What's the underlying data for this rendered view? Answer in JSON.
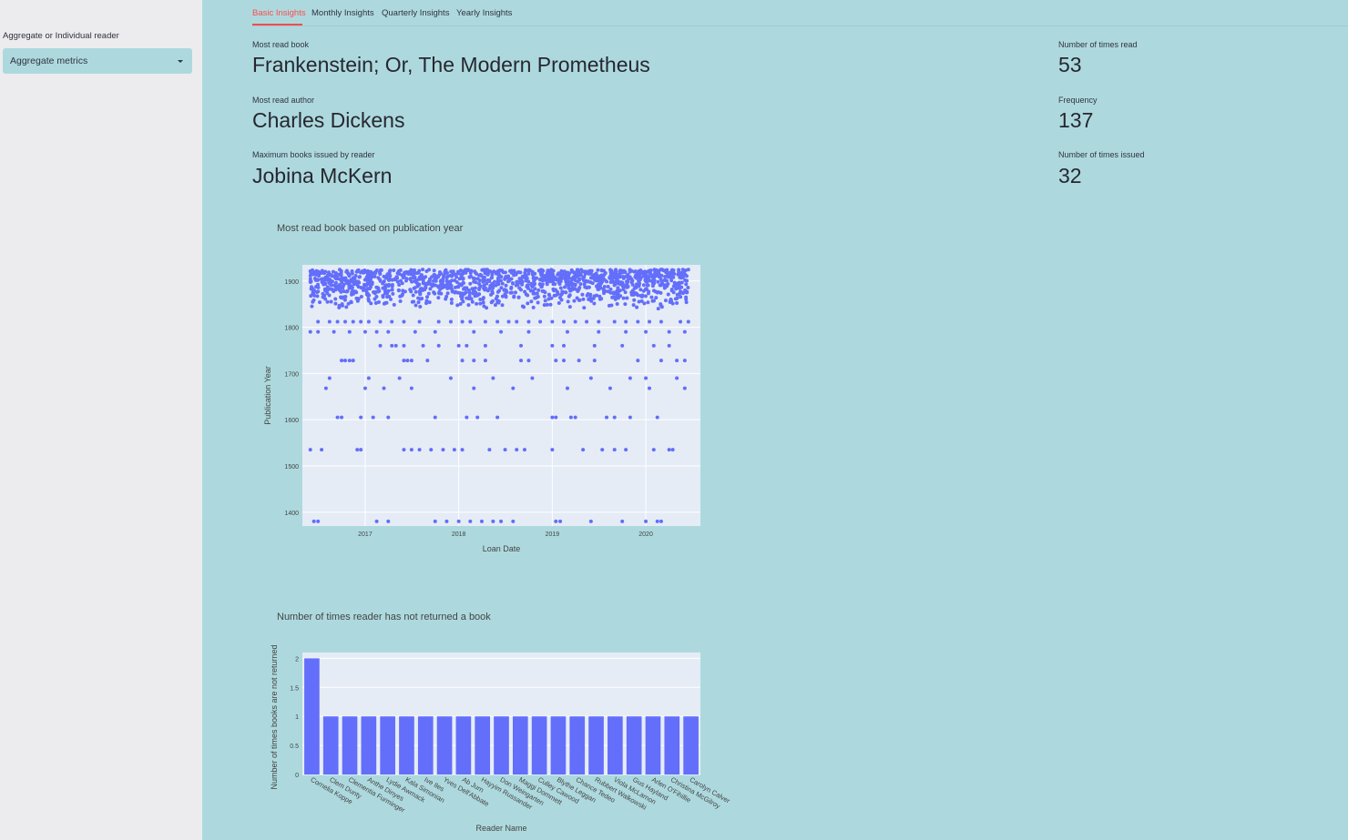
{
  "sidebar": {
    "select_label": "Aggregate or Individual reader",
    "select_value": "Aggregate metrics"
  },
  "tabs": [
    {
      "label": "Basic Insights",
      "active": true
    },
    {
      "label": "Monthly Insights",
      "active": false
    },
    {
      "label": "Quarterly Insights",
      "active": false
    },
    {
      "label": "Yearly Insights",
      "active": false
    }
  ],
  "metrics": {
    "most_read_book": {
      "label": "Most read book",
      "value": "Frankenstein; Or, The Modern Prometheus"
    },
    "times_read": {
      "label": "Number of times read",
      "value": "53"
    },
    "most_read_author": {
      "label": "Most read author",
      "value": "Charles Dickens"
    },
    "frequency": {
      "label": "Frequency",
      "value": "137"
    },
    "max_books_reader": {
      "label": "Maximum books issued by reader",
      "value": "Jobina McKern"
    },
    "times_issued": {
      "label": "Number of times issued",
      "value": "32"
    }
  },
  "colors": {
    "accent": "#ff4b4b",
    "marker": "#636efa",
    "plot_bg": "#e5ecf6",
    "page_bg": "#add9de",
    "sidebar_bg": "#ececee"
  },
  "chart_data": [
    {
      "type": "scatter",
      "title": "Most read book based on publication year",
      "xlabel": "Loan Date",
      "ylabel": "Publication Year",
      "x_ticks": [
        "2017",
        "2018",
        "2019",
        "2020"
      ],
      "y_ticks": [
        "1400",
        "1500",
        "1600",
        "1700",
        "1800",
        "1900"
      ],
      "xlim": [
        "2016-05-01",
        "2020-08-01"
      ],
      "ylim": [
        1370,
        1935
      ],
      "grid": true,
      "series": [
        {
          "bands": [
            {
              "year": 1380,
              "dates": [
                "2016-06-15",
                "2016-07-01",
                "2017-02-15",
                "2017-04-01",
                "2017-10-01",
                "2017-11-15",
                "2018-01-01",
                "2018-02-15",
                "2018-04-01",
                "2018-05-15",
                "2018-06-15",
                "2018-08-01",
                "2019-01-15",
                "2019-02-01",
                "2019-06-01",
                "2019-10-01",
                "2020-01-01",
                "2020-02-15",
                "2020-03-01"
              ]
            },
            {
              "year": 1535,
              "dates": [
                "2016-06-01",
                "2016-07-15",
                "2016-12-01",
                "2016-12-15",
                "2017-06-01",
                "2017-07-01",
                "2017-08-01",
                "2017-09-15",
                "2017-11-01",
                "2017-12-15",
                "2018-01-15",
                "2018-05-01",
                "2018-07-01",
                "2018-08-15",
                "2018-09-15",
                "2019-01-01",
                "2019-05-01",
                "2019-07-15",
                "2019-09-01",
                "2019-10-15",
                "2020-02-01",
                "2020-04-01",
                "2020-04-15"
              ]
            },
            {
              "year": 1605,
              "dates": [
                "2016-09-15",
                "2016-10-01",
                "2016-12-15",
                "2017-02-01",
                "2017-04-01",
                "2017-10-01",
                "2018-02-01",
                "2018-03-15",
                "2018-06-01",
                "2019-01-01",
                "2019-01-15",
                "2019-03-15",
                "2019-04-01",
                "2019-08-01",
                "2019-09-01",
                "2019-11-01",
                "2020-02-15"
              ]
            },
            {
              "year": 1668,
              "dates": [
                "2016-08-01",
                "2017-01-01",
                "2017-03-15",
                "2017-07-01",
                "2018-03-01",
                "2018-08-01",
                "2019-03-01",
                "2019-08-15",
                "2020-01-15",
                "2020-06-01"
              ]
            },
            {
              "year": 1690,
              "dates": [
                "2016-08-15",
                "2017-01-15",
                "2017-05-15",
                "2017-12-01",
                "2018-05-15",
                "2018-10-15",
                "2019-06-01",
                "2019-11-01",
                "2020-01-01",
                "2020-05-01"
              ]
            },
            {
              "year": 1728,
              "dates": [
                "2016-10-01",
                "2016-10-15",
                "2016-11-01",
                "2016-11-15",
                "2017-06-01",
                "2017-06-15",
                "2017-07-01",
                "2017-09-01",
                "2018-01-15",
                "2018-03-01",
                "2018-04-15",
                "2018-09-01",
                "2018-10-01",
                "2019-01-15",
                "2019-02-15",
                "2019-04-15",
                "2019-06-15",
                "2019-12-01",
                "2020-03-01",
                "2020-05-01",
                "2020-06-01"
              ]
            },
            {
              "year": 1760,
              "dates": [
                "2017-03-01",
                "2017-04-15",
                "2017-05-01",
                "2017-06-01",
                "2017-08-15",
                "2017-10-15",
                "2018-01-01",
                "2018-02-01",
                "2018-04-15",
                "2018-09-01",
                "2019-01-01",
                "2019-02-15",
                "2019-06-15",
                "2019-10-01",
                "2020-02-01",
                "2020-04-01"
              ]
            },
            {
              "year": 1790,
              "dates": [
                "2016-06-01",
                "2016-07-01",
                "2016-09-01",
                "2016-11-01",
                "2017-01-01",
                "2017-02-15",
                "2017-04-01",
                "2017-07-15",
                "2017-10-01",
                "2018-03-01",
                "2018-06-15",
                "2018-10-01",
                "2019-03-01",
                "2019-07-01",
                "2019-10-15",
                "2020-01-01",
                "2020-04-01",
                "2020-06-01"
              ]
            },
            {
              "year": 1812,
              "dates": [
                "2016-07-01",
                "2016-08-15",
                "2016-09-15",
                "2016-10-15",
                "2016-11-15",
                "2016-12-15",
                "2017-01-15",
                "2017-03-01",
                "2017-04-15",
                "2017-06-01",
                "2017-08-01",
                "2017-10-15",
                "2017-12-01",
                "2018-01-15",
                "2018-02-15",
                "2018-04-15",
                "2018-06-01",
                "2018-07-15",
                "2018-08-15",
                "2018-10-01",
                "2018-11-15",
                "2019-01-01",
                "2019-02-15",
                "2019-04-01",
                "2019-05-15",
                "2019-07-01",
                "2019-09-01",
                "2019-10-15",
                "2019-12-01",
                "2020-01-15",
                "2020-03-01",
                "2020-05-15",
                "2020-06-15"
              ]
            }
          ],
          "dense_band": {
            "start": "2016-06-01",
            "end": "2020-06-15",
            "ymin": 1840,
            "ymax": 1925
          }
        }
      ]
    },
    {
      "type": "bar",
      "title": "Number of times reader has not returned a book",
      "xlabel": "Reader Name",
      "ylabel": "Number of times books are not returned",
      "y_ticks": [
        "0",
        "0.5",
        "1",
        "1.5",
        "2"
      ],
      "ylim": [
        0,
        2.1
      ],
      "grid": true,
      "categories": [
        "Cornelia Koppe",
        "Clem Dunty",
        "Clementia Furminger",
        "Anthe Dinyes",
        "Lydie Awmack",
        "Kala Simonian",
        "Ive Iles",
        "Yves Dell'Abbate",
        "Ab Jurn",
        "Hayyim Russander",
        "Don Weingarten",
        "Maggi Dommett",
        "Culley Cawood",
        "Blythe Leggan",
        "Chance Tedeo",
        "Rubbert Walkowski",
        "Viola McLarnon",
        "Gus Hayland",
        "Arlen O'Fihillie",
        "Christina McGilroy",
        "Carolyn Calver"
      ],
      "values": [
        2,
        1,
        1,
        1,
        1,
        1,
        1,
        1,
        1,
        1,
        1,
        1,
        1,
        1,
        1,
        1,
        1,
        1,
        1,
        1,
        1
      ]
    }
  ]
}
